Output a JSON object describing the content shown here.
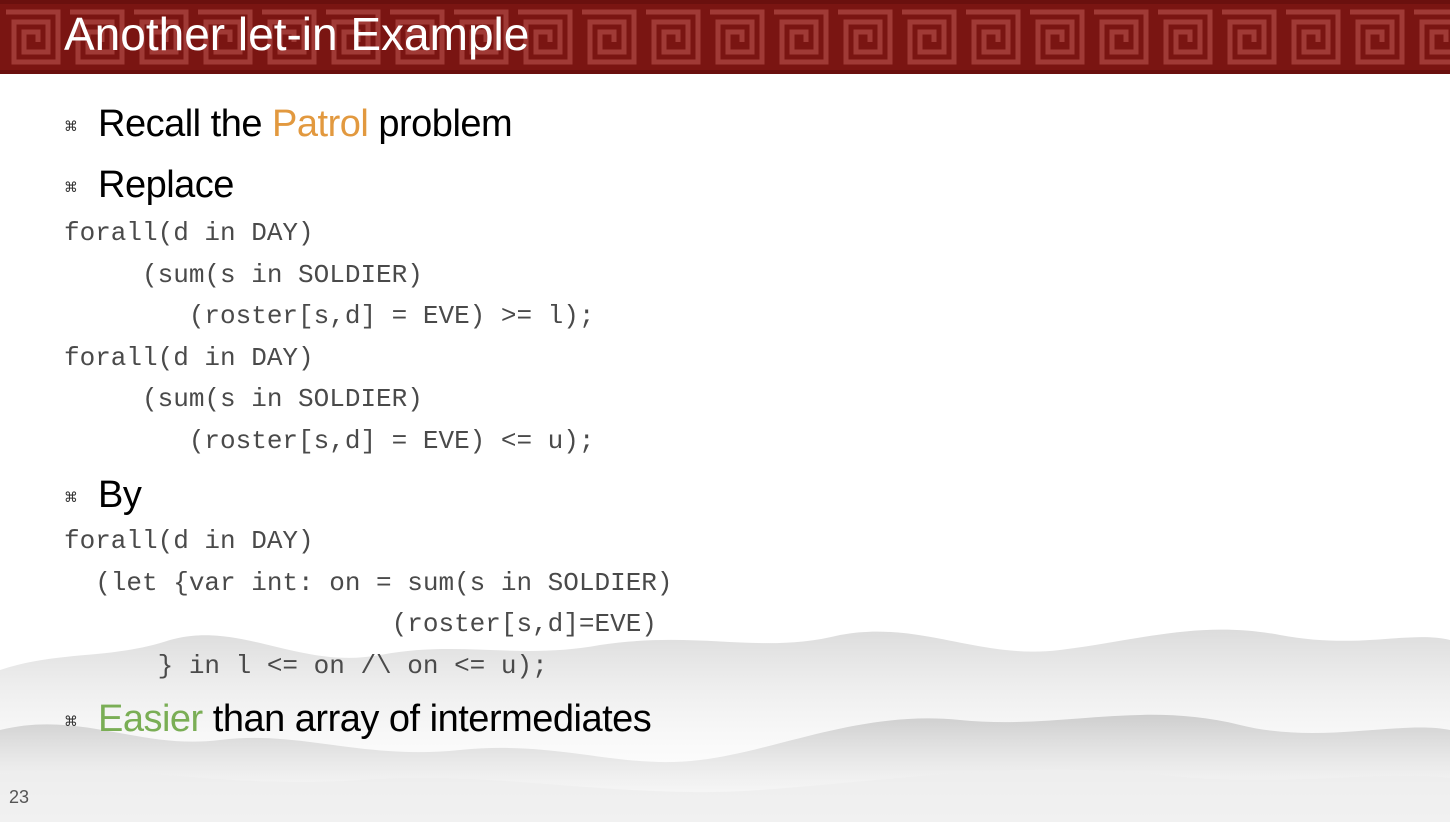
{
  "slide": {
    "title": "Another let-in Example",
    "number": "23"
  },
  "bullets": [
    {
      "parts": [
        "Recall the ",
        "Patrol",
        " problem"
      ]
    },
    {
      "parts": [
        "Replace"
      ]
    },
    {
      "parts": [
        "By"
      ]
    },
    {
      "parts": [
        "Easier",
        " than array of intermediates"
      ]
    }
  ],
  "code_blocks": {
    "replace": [
      "forall(d in DAY)",
      "     (sum(s in SOLDIER)",
      "        (roster[s,d] = EVE) >= l);",
      "forall(d in DAY)",
      "     (sum(s in SOLDIER)",
      "        (roster[s,d] = EVE) <= u);"
    ],
    "by": [
      "forall(d in DAY)",
      "  (let {var int: on = sum(s in SOLDIER)",
      "                     (roster[s,d]=EVE)",
      "      } in l <= on /\\ on <= u);"
    ]
  },
  "icons": {
    "bullet": "bullet-square-knot-icon"
  },
  "colors": {
    "header_bg": "#7a1512",
    "highlight_orange": "#e2993f",
    "highlight_green": "#7aae55",
    "code_text": "#4a4a4a"
  }
}
